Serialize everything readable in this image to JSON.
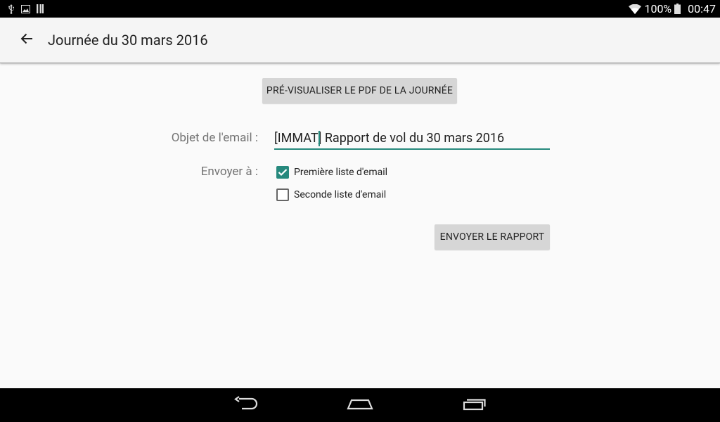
{
  "status_bar": {
    "battery_percent": "100%",
    "time": "00:47",
    "icons": [
      "usb-icon",
      "image-icon",
      "barcode-icon",
      "wifi-icon",
      "battery-icon"
    ]
  },
  "app_bar": {
    "title": "Journée du 30 mars 2016",
    "back_icon": "arrow-back-icon"
  },
  "actions": {
    "preview_pdf_label": "PRÉ-VISUALISER LE PDF DE LA JOURNÉE",
    "send_report_label": "ENVOYER LE RAPPORT"
  },
  "form": {
    "subject_label": "Objet de l'email :",
    "subject_value": "[IMMAT] Rapport de vol du 30 mars 2016",
    "send_to_label": "Envoyer à :",
    "recipients": [
      {
        "label": "Première liste d'email",
        "checked": true
      },
      {
        "label": "Seconde liste d'email",
        "checked": false
      }
    ]
  },
  "colors": {
    "accent": "#26897d",
    "app_bar_bg": "#f5f5f5",
    "button_bg": "#d6d6d6"
  },
  "nav_bar": {
    "icons": [
      "nav-back-icon",
      "nav-home-icon",
      "nav-recents-icon"
    ]
  }
}
